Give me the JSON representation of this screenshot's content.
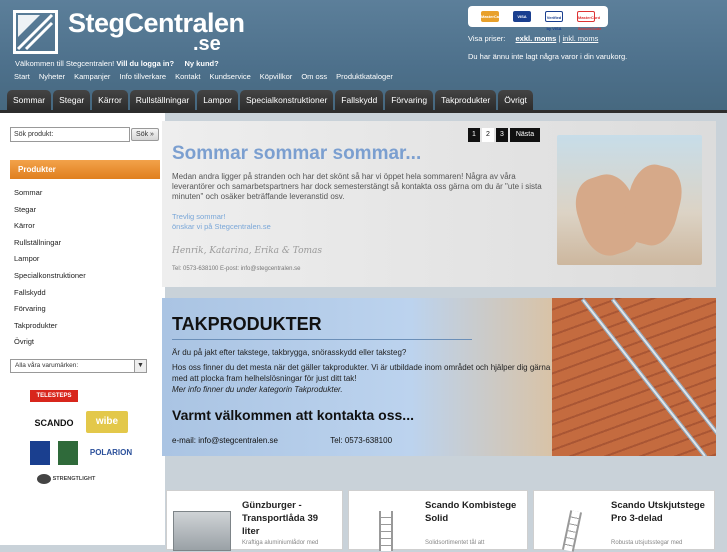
{
  "header": {
    "logo_main": "StegCentralen",
    "logo_suffix": ".se",
    "welcome_text": "Välkommen till Stegcentralen!",
    "login_link": "Vill du logga in?",
    "new_customer_link": "Ny kund?",
    "top_nav": [
      "Start",
      "Nyheter",
      "Kampanjer",
      "Info tillverkare",
      "Kontakt",
      "Kundservice",
      "Köpvillkor",
      "Om oss",
      "Produktkataloger"
    ],
    "payment_cards": [
      "MasterCard",
      "VISA",
      "Verified by VISA",
      "MasterCard SecureCode"
    ],
    "prices_label": "Visa priser:",
    "price_excl": "exkl. moms",
    "price_sep": "|",
    "price_incl": "inkl. moms",
    "cart_message": "Du har ännu inte lagt några varor i din varukorg."
  },
  "tabs": [
    "Sommar",
    "Stegar",
    "Kärror",
    "Rullställningar",
    "Lampor",
    "Specialkonstruktioner",
    "Fallskydd",
    "Förvaring",
    "Takprodukter",
    "Övrigt"
  ],
  "sidebar": {
    "search_placeholder": "Sök produkt:",
    "search_button": "Sök »",
    "categories_header": "Produkter",
    "categories": [
      "Sommar",
      "Stegar",
      "Kärror",
      "Rullställningar",
      "Lampor",
      "Specialkonstruktioner",
      "Fallskydd",
      "Förvaring",
      "Takprodukter",
      "Övrigt"
    ],
    "brand_select": "Alla våra varumärken:",
    "brands": [
      "TELESTEPS",
      "SCANDO",
      "wibe",
      "POLARION",
      "STRENGTLIGHT"
    ]
  },
  "banner_summer": {
    "title": "Sommar sommar sommar...",
    "text": "Medan andra ligger på stranden och har det skönt så har vi öppet hela sommaren! Några av våra leverantörer och samarbetspartners har dock semesterstängt så kontakta oss gärna om du är \"ute i sista minuten\" och osäker beträffande leveranstid osv.",
    "greeting1": "Trevlig sommar!",
    "greeting2": "önskar vi på Stegcentralen.se",
    "signature": "Henrik, Katarina, Erika & Tomas",
    "contact": "Tel: 0573-638100      E-post: info@stegcentralen.se",
    "pager": [
      "1",
      "2",
      "3"
    ],
    "pager_next": "Nästa",
    "pager_active": 2
  },
  "banner_roof": {
    "title": "TAKPRODUKTER",
    "text1": "Är du på jakt efter takstege, takbrygga, snörasskydd eller taksteg?",
    "text2": "Hos oss finner du det mesta när det gäller takprodukter. Vi är utbildade inom området och hjälper dig gärna med att plocka fram helhelslösningar för just ditt tak!",
    "text3": "Mer info finner du under kategorin Takprodukter.",
    "welcome": "Varmt välkommen att kontakta oss...",
    "email": "e-mail:  info@stegcentralen.se",
    "phone": "Tel: 0573-638100"
  },
  "products": [
    {
      "title": "Günzburger - Transportlåda 39 liter",
      "desc": "Kraftiga aluminiumlådor med"
    },
    {
      "title": "Scando Kombistege Solid",
      "desc": "Solidsortimentet tål att"
    },
    {
      "title": "Scando Utskjutstege Pro 3-delad",
      "desc": "Robusta utsjutsstegar med"
    }
  ],
  "colors": {
    "header_blue": "#4d708b",
    "tab_dark": "#2b2b2b",
    "category_orange": "#e07f1e",
    "summer_title": "#7b9fd0"
  }
}
